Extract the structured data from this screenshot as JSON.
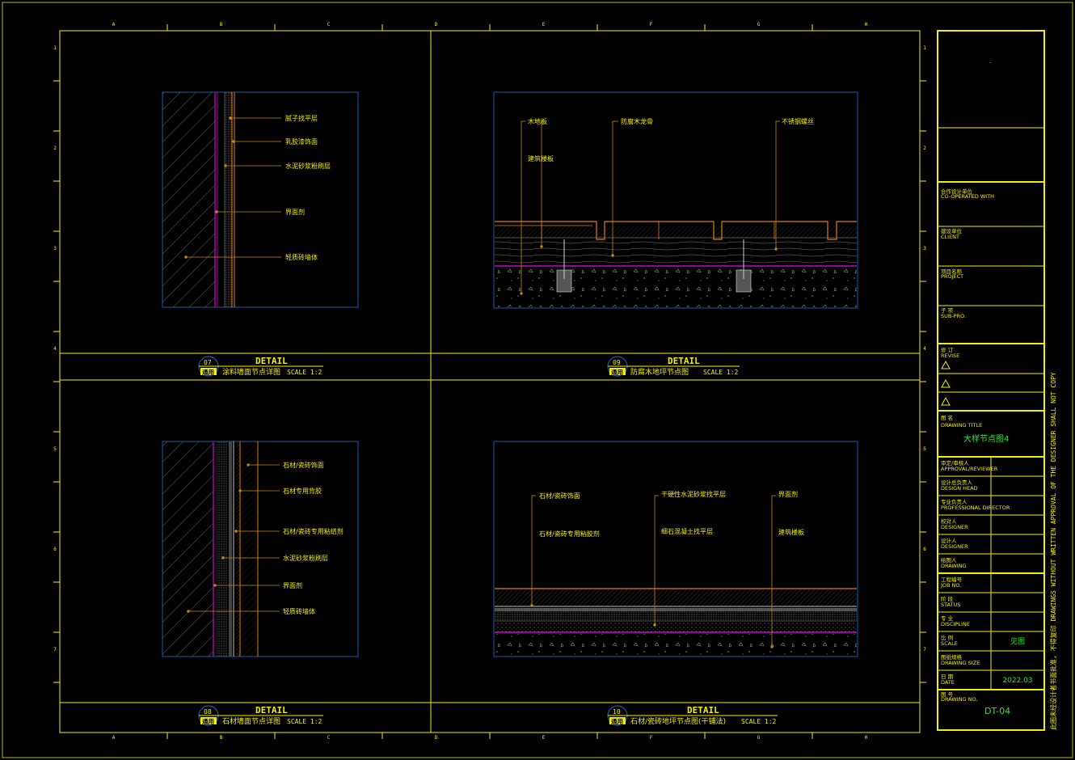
{
  "grid": {
    "columns": [
      "A",
      "B",
      "C",
      "D",
      "E",
      "F",
      "G",
      "H"
    ],
    "rows": [
      "1",
      "2",
      "3",
      "4",
      "5",
      "6",
      "7"
    ]
  },
  "details": [
    {
      "id": "07",
      "tag": "通用",
      "heading": "DETAIL",
      "title": "涂料墙面节点详图",
      "scale": "SCALE 1:2",
      "labels": [
        "腻子找平层",
        "乳胶漆饰面",
        "水泥砂浆粉刷层",
        "界面剂",
        "轻质砖墙体"
      ]
    },
    {
      "id": "09",
      "tag": "通用",
      "heading": "DETAIL",
      "title": "防腐木地坪节点图",
      "scale": "SCALE 1:2",
      "labels": [
        "木地板",
        "防腐木龙骨",
        "不锈钢螺丝",
        "建筑楼板"
      ]
    },
    {
      "id": "08",
      "tag": "通用",
      "heading": "DETAIL",
      "title": "石材墙面节点详图",
      "scale": "SCALE 1:2",
      "labels": [
        "石材/瓷砖饰面",
        "石材专用背胶",
        "石材/瓷砖专用粘结剂",
        "水泥砂浆粉刷层",
        "界面剂",
        "轻质砖墙体"
      ]
    },
    {
      "id": "10",
      "tag": "通用",
      "heading": "DETAIL",
      "title": "石材/瓷砖地坪节点图(干铺法)",
      "scale": "SCALE 1:2",
      "labels": [
        "石材/瓷砖饰面",
        "石材/瓷砖专用粘胶剂",
        "干硬性水泥砂浆找平层",
        "细石混凝土找平层",
        "界面剂",
        "建筑楼板"
      ]
    }
  ],
  "title_block": {
    "logo_mark": "-",
    "co_operated": {
      "cn": "合作设计单位",
      "en": "CO-OPERATED WITH"
    },
    "client": {
      "cn": "建设单位",
      "en": "CLIENT"
    },
    "project": {
      "cn": "项目名称",
      "en": "PROJECT"
    },
    "sub_pro": {
      "cn": "子 项",
      "en": "SUB-PRO."
    },
    "revise": {
      "cn": "修 订",
      "en": "REVISE"
    },
    "drawing_title": {
      "cn": "图 名",
      "en": "DRAWING TITLE",
      "value": "大样节点图4"
    },
    "rows": [
      {
        "cn": "审定/审核人",
        "en": "APPROVAL/REVIEWER",
        "value": ""
      },
      {
        "cn": "设计总负责人",
        "en": "DESIGN HEAD",
        "value": ""
      },
      {
        "cn": "专业负责人",
        "en": "PROFESSIONAL DIRECTOR",
        "value": ""
      },
      {
        "cn": "校对人",
        "en": "DESIGNER",
        "value": ""
      },
      {
        "cn": "设计人",
        "en": "DESIGNER",
        "value": ""
      },
      {
        "cn": "绘图人",
        "en": "DRAWING",
        "value": ""
      },
      {
        "cn": "工程编号",
        "en": "JOB NO.",
        "value": ""
      },
      {
        "cn": "阶 段",
        "en": "STATUS",
        "value": ""
      },
      {
        "cn": "专 业",
        "en": "DISCIPLINE",
        "value": ""
      },
      {
        "cn": "比 例",
        "en": "SCALE",
        "value": "见图"
      },
      {
        "cn": "图纸规格",
        "en": "DRAWING SIZE",
        "value": ""
      },
      {
        "cn": "日 期",
        "en": "DATE",
        "value": "2022.03"
      }
    ],
    "drawing_no": {
      "cn": "图 号",
      "en": "DRAWING NO.",
      "value": "DT-04"
    }
  },
  "side_note": "此图未经设计者书面批准, 不得复印 DRAWINGS WITHOUT WRITTEN APPROVAL OF THE DESIGNER SHALL NOT COPY",
  "colors": {
    "frame": "#f2ee00",
    "detail_border": "#1a5aa0",
    "magenta": "#d000d0",
    "orange": "#e07a10",
    "leader": "#c08a10",
    "green": "#2ee62e"
  }
}
